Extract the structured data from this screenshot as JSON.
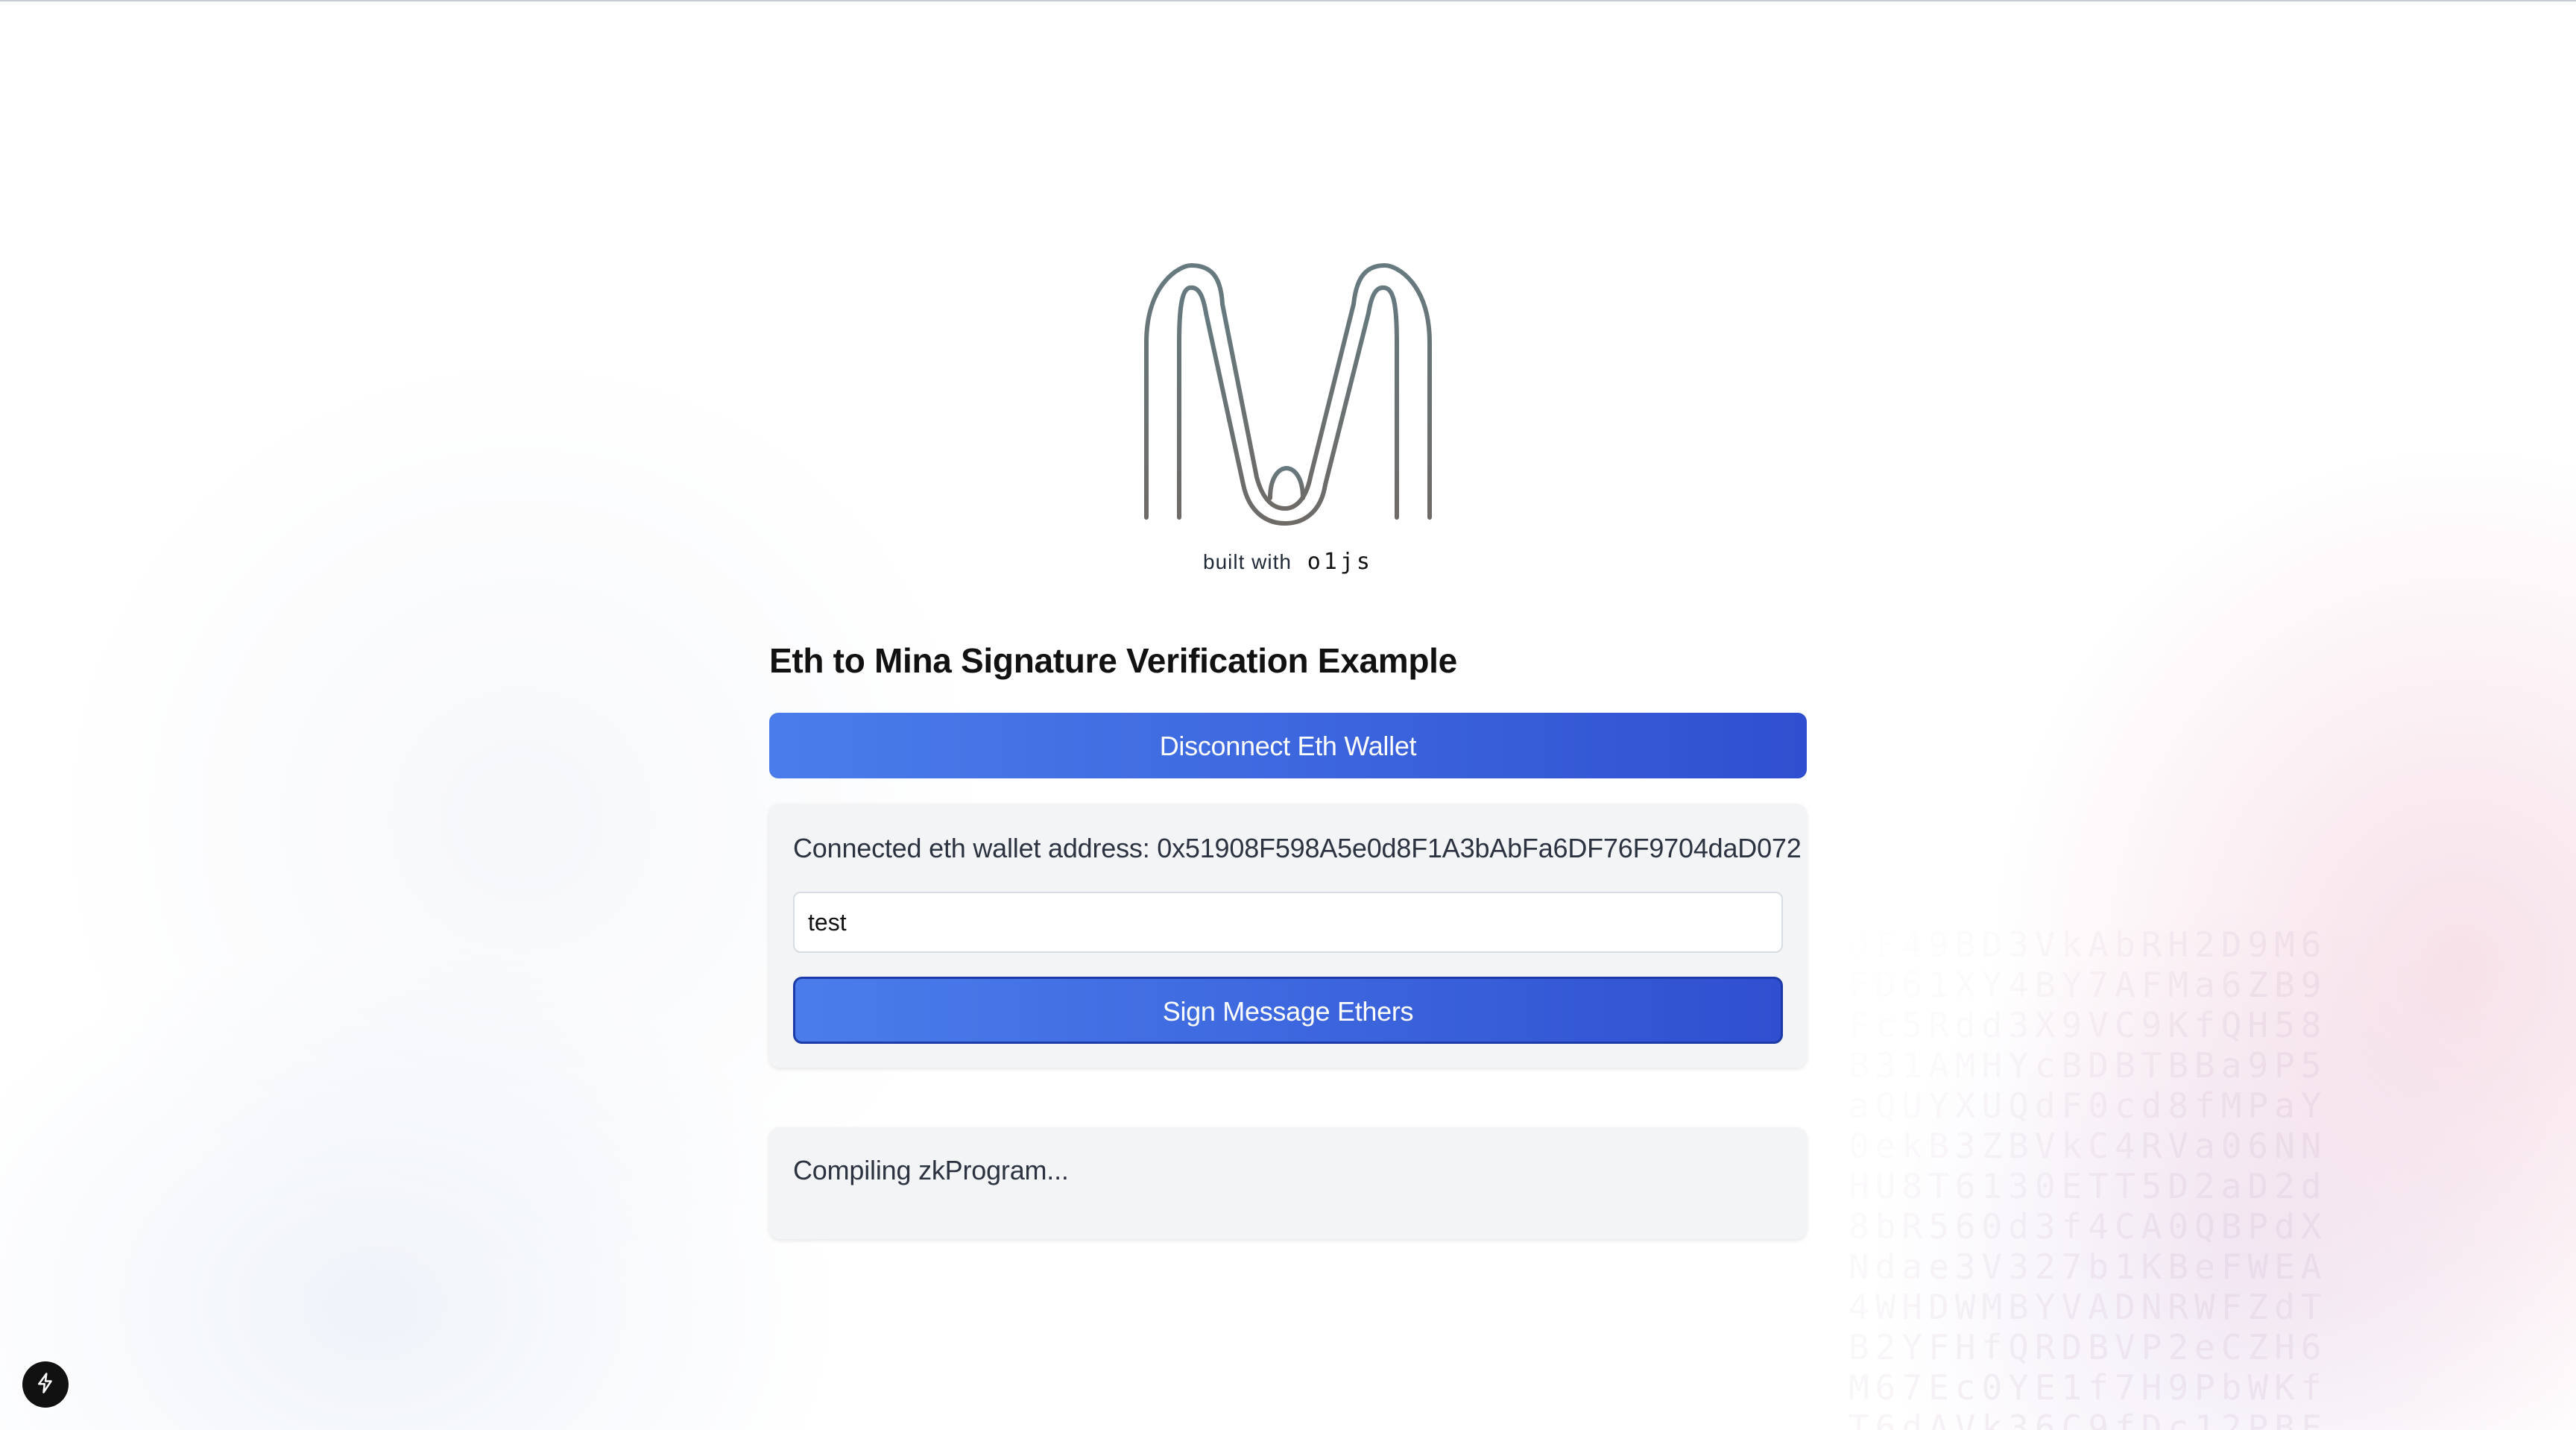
{
  "branding": {
    "logo_icon": "mina-logo-icon",
    "built_with_prefix": "built with",
    "built_with_name": "o1js"
  },
  "page": {
    "title": "Eth to Mina Signature Verification Example"
  },
  "wallet": {
    "disconnect_label": "Disconnect Eth Wallet",
    "connected_label": "Connected eth wallet address: 0x51908F598A5e0d8F1A3bAbFa6DF76F9704daD072"
  },
  "sign_form": {
    "message_value": "test",
    "sign_label": "Sign Message Ethers"
  },
  "status": {
    "text": "Compiling zkProgram..."
  },
  "dev_tools": {
    "icon": "lightning-icon"
  },
  "colors": {
    "button_gradient_start": "#4a7deb",
    "button_gradient_end": "#2f4fd0",
    "card_bg": "#f3f4f6",
    "logo_stroke": "#6b787d"
  }
}
